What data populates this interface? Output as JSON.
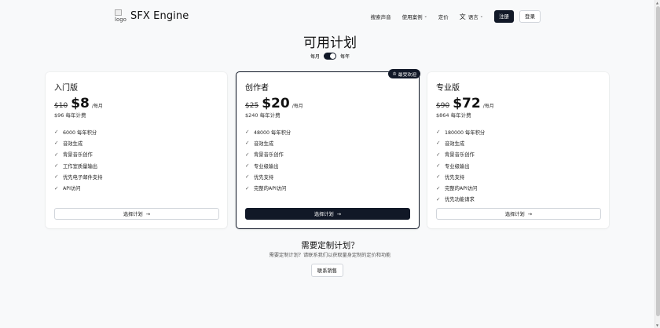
{
  "header": {
    "logo_alt": "logo",
    "brand": "SFX Engine",
    "nav": {
      "search_sounds": "搜索声音",
      "use_cases": "使用案例",
      "pricing": "定价",
      "language": "语言",
      "signup": "注册",
      "login": "登录"
    }
  },
  "title": "可用计划",
  "billing": {
    "monthly": "每月",
    "yearly": "每年",
    "selected": "每年"
  },
  "plans": [
    {
      "name": "入门版",
      "old_price": "$10",
      "price": "$8",
      "per": "/每月",
      "yearly": "$96 每年计费",
      "features": [
        "6000 每年积分",
        "音效生成",
        "背景音乐创作",
        "工作室质量输出",
        "优先电子邮件支持",
        "API访问"
      ],
      "button": "选择计划"
    },
    {
      "name": "创作者",
      "badge": "最受欢迎",
      "old_price": "$25",
      "price": "$20",
      "per": "/每月",
      "yearly": "$240 每年计费",
      "features": [
        "48000 每年积分",
        "音效生成",
        "背景音乐创作",
        "专业级输出",
        "优先支持",
        "完整的API访问"
      ],
      "button": "选择计划"
    },
    {
      "name": "专业版",
      "old_price": "$90",
      "price": "$72",
      "per": "/每月",
      "yearly": "$864 每年计费",
      "features": [
        "180000 每年积分",
        "音效生成",
        "背景音乐创作",
        "专业级输出",
        "优先支持",
        "完整的API访问",
        "优先功能请求"
      ],
      "button": "选择计划"
    }
  ],
  "custom": {
    "title": "需要定制计划？",
    "subtitle": "需要定制计划？请联系我们以获取量身定制的定价和功能",
    "button": "联系销售"
  },
  "colors": {
    "primary": "#111827",
    "background": "#f8f9fa",
    "card": "#ffffff",
    "border": "#d1d5db"
  }
}
